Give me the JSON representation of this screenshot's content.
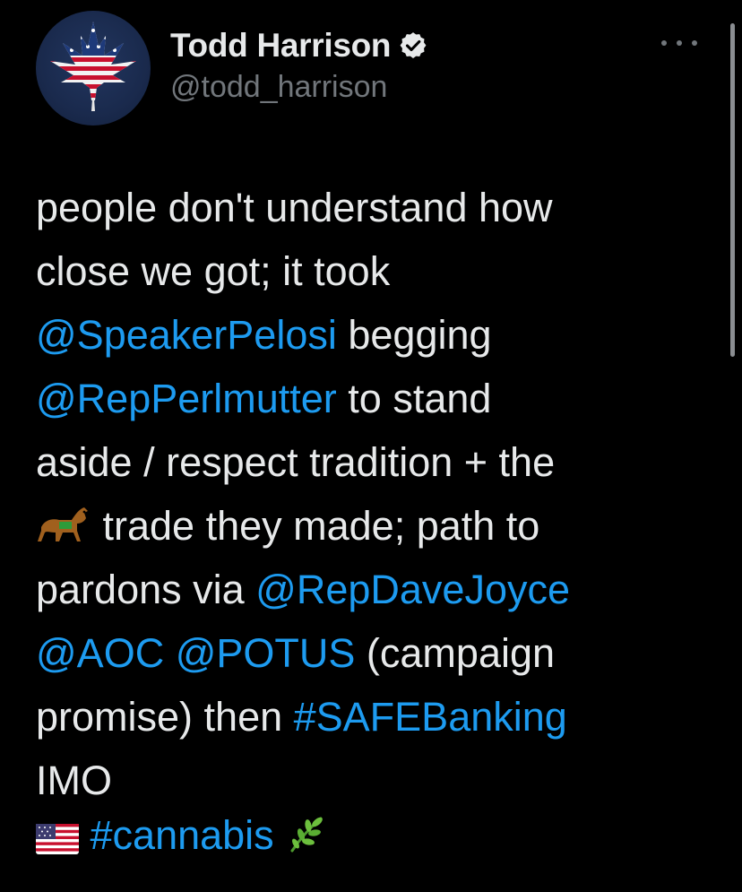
{
  "author": {
    "display_name": "Todd Harrison",
    "handle": "@todd_harrison",
    "verified": true,
    "avatar_icon": "cannabis-leaf-american-flag"
  },
  "tweet": {
    "lines": [
      {
        "parts": [
          {
            "type": "text",
            "text": "people don't understand how"
          }
        ]
      },
      {
        "parts": [
          {
            "type": "text",
            "text": "close we got; it took"
          }
        ]
      },
      {
        "parts": [
          {
            "type": "mention",
            "text": "@SpeakerPelosi"
          },
          {
            "type": "text",
            "text": " begging"
          }
        ]
      },
      {
        "parts": [
          {
            "type": "mention",
            "text": "@RepPerlmutter"
          },
          {
            "type": "text",
            "text": " to stand"
          }
        ]
      },
      {
        "parts": [
          {
            "type": "text",
            "text": "aside / respect tradition + the"
          }
        ]
      },
      {
        "parts": [
          {
            "type": "emoji",
            "icon": "horse-emoji"
          },
          {
            "type": "text",
            "text": " trade they made; path to"
          }
        ]
      },
      {
        "parts": [
          {
            "type": "text",
            "text": "pardons via "
          },
          {
            "type": "mention",
            "text": "@RepDaveJoyce"
          }
        ]
      },
      {
        "parts": [
          {
            "type": "mention",
            "text": "@AOC"
          },
          {
            "type": "text",
            "text": " "
          },
          {
            "type": "mention",
            "text": "@POTUS"
          },
          {
            "type": "text",
            "text": " (campaign"
          }
        ]
      },
      {
        "parts": [
          {
            "type": "text",
            "text": "promise) then "
          },
          {
            "type": "hashtag",
            "text": "#SAFEBanking"
          }
        ]
      },
      {
        "parts": [
          {
            "type": "text",
            "text": "IMO"
          }
        ]
      }
    ],
    "footer": [
      {
        "type": "emoji",
        "icon": "us-flag-emoji"
      },
      {
        "type": "text",
        "text": " "
      },
      {
        "type": "hashtag",
        "text": "#cannabis"
      },
      {
        "type": "text",
        "text": " "
      },
      {
        "type": "emoji",
        "icon": "herb-emoji"
      }
    ]
  },
  "colors": {
    "background": "#000000",
    "text": "#e7e9ea",
    "secondary": "#71767b",
    "link": "#1d9bf0"
  }
}
